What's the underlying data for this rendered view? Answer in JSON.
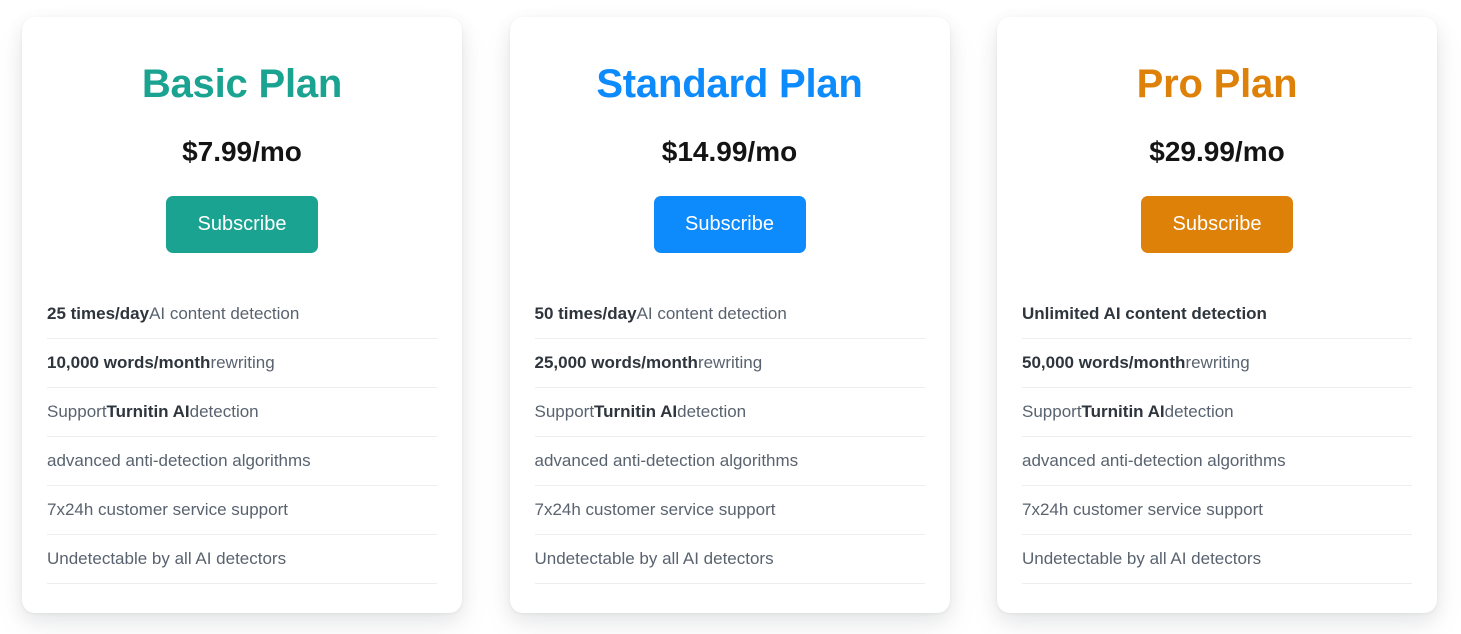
{
  "page": {
    "background_color": "#ffffff",
    "section_name": "pricing-plans"
  },
  "plans": [
    {
      "id": "basic",
      "title": "Basic Plan",
      "price": "$7.99/mo",
      "button_label": "Subscribe",
      "accent_color": "#1ba391",
      "button_color": "#1ba391",
      "features": [
        {
          "strong": "25 times/day",
          "rest": " AI content detection"
        },
        {
          "strong": "10,000 words/month",
          "rest": " rewriting"
        },
        {
          "lead": "Support ",
          "strong": "Turnitin AI",
          "rest": " detection"
        },
        {
          "rest": "advanced anti-detection algorithms"
        },
        {
          "rest": "7x24h customer service support"
        },
        {
          "rest": "Undetectable by all AI detectors"
        }
      ]
    },
    {
      "id": "standard",
      "title": "Standard Plan",
      "price": "$14.99/mo",
      "button_label": "Subscribe",
      "accent_color": "#0d8bfd",
      "button_color": "#0d8bfd",
      "features": [
        {
          "strong": "50 times/day",
          "rest": " AI content detection"
        },
        {
          "strong": "25,000 words/month",
          "rest": " rewriting"
        },
        {
          "lead": "Support ",
          "strong": "Turnitin AI",
          "rest": " detection"
        },
        {
          "rest": "advanced anti-detection algorithms"
        },
        {
          "rest": "7x24h customer service support"
        },
        {
          "rest": "Undetectable by all AI detectors"
        }
      ]
    },
    {
      "id": "pro",
      "title": "Pro Plan",
      "price": "$29.99/mo",
      "button_label": "Subscribe",
      "accent_color": "#dd8109",
      "button_color": "#dd8109",
      "features": [
        {
          "strong": "Unlimited AI content detection"
        },
        {
          "strong": "50,000 words/month",
          "rest": " rewriting"
        },
        {
          "lead": "Support ",
          "strong": "Turnitin AI",
          "rest": " detection"
        },
        {
          "rest": "advanced anti-detection algorithms"
        },
        {
          "rest": "7x24h customer service support"
        },
        {
          "rest": "Undetectable by all AI detectors"
        }
      ]
    }
  ]
}
